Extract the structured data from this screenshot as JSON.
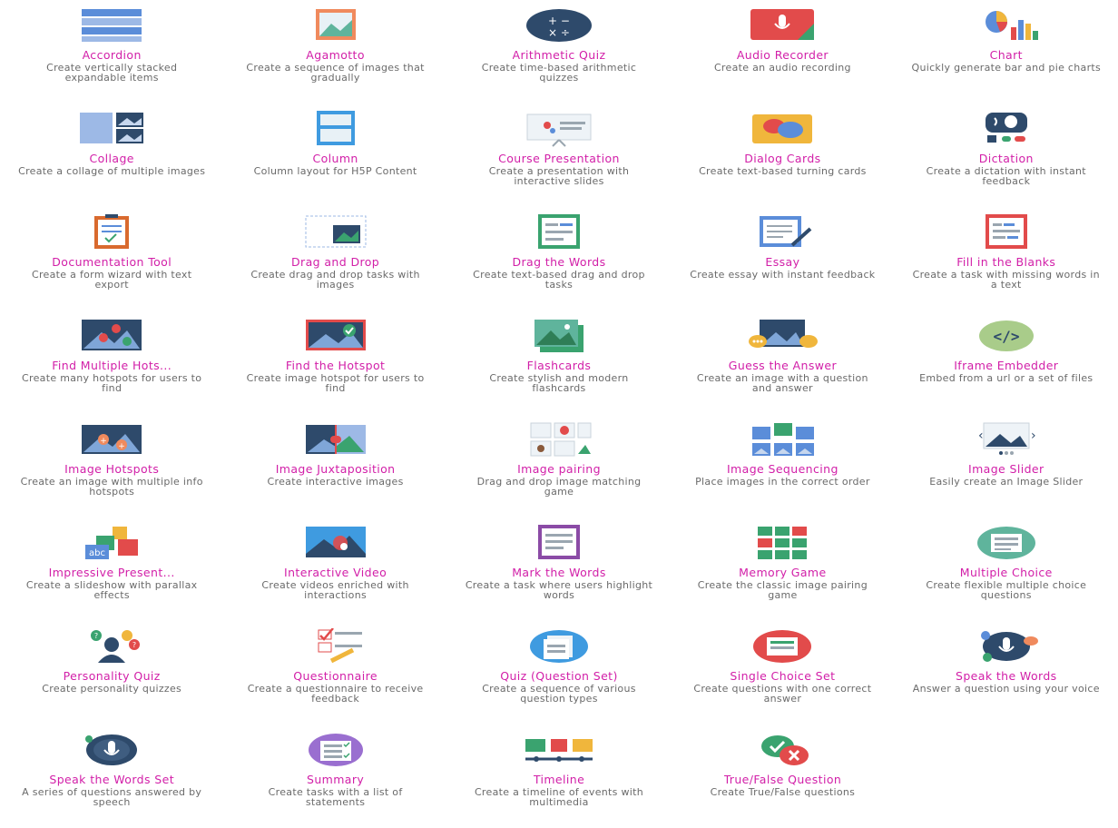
{
  "tiles": [
    {
      "title": "Accordion",
      "desc": "Create vertically stacked expandable items",
      "icon": "accordion-icon"
    },
    {
      "title": "Agamotto",
      "desc": "Create a sequence of images that gradually",
      "icon": "agamotto-icon"
    },
    {
      "title": "Arithmetic Quiz",
      "desc": "Create time-based arithmetic quizzes",
      "icon": "arithmetic-quiz-icon"
    },
    {
      "title": "Audio Recorder",
      "desc": "Create an audio recording",
      "icon": "audio-recorder-icon"
    },
    {
      "title": "Chart",
      "desc": "Quickly generate bar and pie charts",
      "icon": "chart-icon"
    },
    {
      "title": "Collage",
      "desc": "Create a collage of multiple images",
      "icon": "collage-icon"
    },
    {
      "title": "Column",
      "desc": "Column layout for H5P Content",
      "icon": "column-icon"
    },
    {
      "title": "Course Presentation",
      "desc": "Create a presentation with interactive slides",
      "icon": "course-presentation-icon"
    },
    {
      "title": "Dialog Cards",
      "desc": "Create text-based turning cards",
      "icon": "dialog-cards-icon"
    },
    {
      "title": "Dictation",
      "desc": "Create a dictation with instant feedback",
      "icon": "dictation-icon"
    },
    {
      "title": "Documentation Tool",
      "desc": "Create a form wizard with text export",
      "icon": "documentation-tool-icon"
    },
    {
      "title": "Drag and Drop",
      "desc": "Create drag and drop tasks with images",
      "icon": "drag-and-drop-icon"
    },
    {
      "title": "Drag the Words",
      "desc": "Create text-based drag and drop tasks",
      "icon": "drag-the-words-icon"
    },
    {
      "title": "Essay",
      "desc": "Create essay with instant feedback",
      "icon": "essay-icon"
    },
    {
      "title": "Fill in the Blanks",
      "desc": "Create a task with missing words in a text",
      "icon": "fill-in-the-blanks-icon"
    },
    {
      "title": "Find Multiple Hots...",
      "desc": "Create many hotspots for users to find",
      "icon": "find-multiple-hotspots-icon"
    },
    {
      "title": "Find the Hotspot",
      "desc": "Create image hotspot for users to find",
      "icon": "find-the-hotspot-icon"
    },
    {
      "title": "Flashcards",
      "desc": "Create stylish and modern flashcards",
      "icon": "flashcards-icon"
    },
    {
      "title": "Guess the Answer",
      "desc": "Create an image with a question and answer",
      "icon": "guess-the-answer-icon"
    },
    {
      "title": "Iframe Embedder",
      "desc": "Embed from a url or a set of files",
      "icon": "iframe-embedder-icon"
    },
    {
      "title": "Image Hotspots",
      "desc": "Create an image with multiple info hotspots",
      "icon": "image-hotspots-icon"
    },
    {
      "title": "Image Juxtaposition",
      "desc": "Create interactive images",
      "icon": "image-juxtaposition-icon"
    },
    {
      "title": "Image pairing",
      "desc": "Drag and drop image matching game",
      "icon": "image-pairing-icon"
    },
    {
      "title": "Image Sequencing",
      "desc": "Place images in the correct order",
      "icon": "image-sequencing-icon"
    },
    {
      "title": "Image Slider",
      "desc": "Easily create an Image Slider",
      "icon": "image-slider-icon"
    },
    {
      "title": "Impressive Present...",
      "desc": "Create a slideshow with parallax effects",
      "icon": "impressive-presentation-icon"
    },
    {
      "title": "Interactive Video",
      "desc": "Create videos enriched with interactions",
      "icon": "interactive-video-icon"
    },
    {
      "title": "Mark the Words",
      "desc": "Create a task where users highlight words",
      "icon": "mark-the-words-icon"
    },
    {
      "title": "Memory Game",
      "desc": "Create the classic image pairing game",
      "icon": "memory-game-icon"
    },
    {
      "title": "Multiple Choice",
      "desc": "Create flexible multiple choice questions",
      "icon": "multiple-choice-icon"
    },
    {
      "title": "Personality Quiz",
      "desc": "Create personality quizzes",
      "icon": "personality-quiz-icon"
    },
    {
      "title": "Questionnaire",
      "desc": "Create a questionnaire to receive feedback",
      "icon": "questionnaire-icon"
    },
    {
      "title": "Quiz (Question Set)",
      "desc": "Create a sequence of various question types",
      "icon": "question-set-icon"
    },
    {
      "title": "Single Choice Set",
      "desc": "Create questions with one correct answer",
      "icon": "single-choice-set-icon"
    },
    {
      "title": "Speak the Words",
      "desc": "Answer a question using your voice",
      "icon": "speak-the-words-icon"
    },
    {
      "title": "Speak the Words Set",
      "desc": "A series of questions answered by speech",
      "icon": "speak-the-words-set-icon"
    },
    {
      "title": "Summary",
      "desc": "Create tasks with a list of statements",
      "icon": "summary-icon"
    },
    {
      "title": "Timeline",
      "desc": "Create a timeline of events with multimedia",
      "icon": "timeline-icon"
    },
    {
      "title": "True/False Question",
      "desc": "Create True/False questions",
      "icon": "true-false-icon"
    }
  ],
  "colors": {
    "title": "#d21fa8",
    "desc": "#6a6a6a"
  }
}
